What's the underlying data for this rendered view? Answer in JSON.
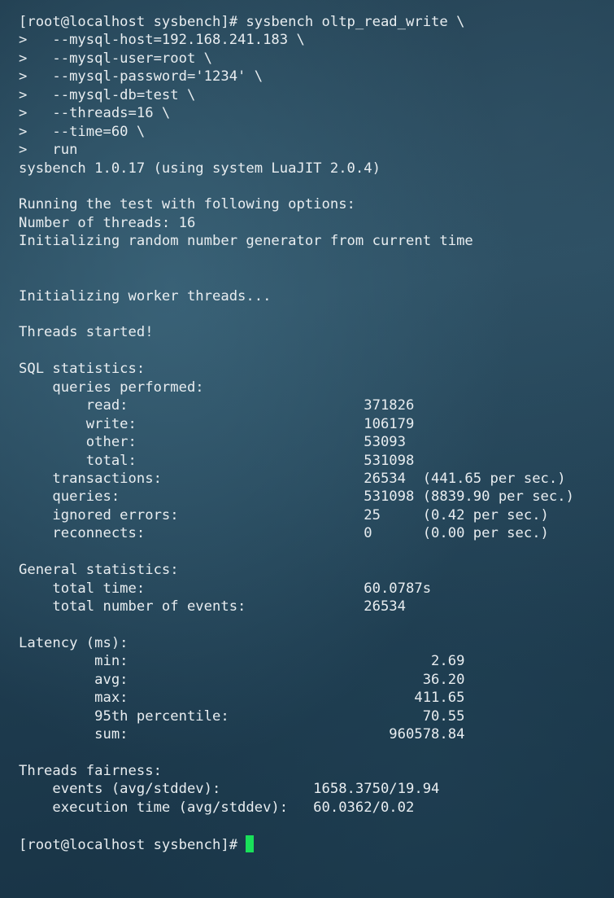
{
  "terminal": {
    "lines": [
      "[root@localhost sysbench]# sysbench oltp_read_write \\",
      ">   --mysql-host=192.168.241.183 \\",
      ">   --mysql-user=root \\",
      ">   --mysql-password='1234' \\",
      ">   --mysql-db=test \\",
      ">   --threads=16 \\",
      ">   --time=60 \\",
      ">   run",
      "sysbench 1.0.17 (using system LuaJIT 2.0.4)",
      "",
      "Running the test with following options:",
      "Number of threads: 16",
      "Initializing random number generator from current time",
      "",
      "",
      "Initializing worker threads...",
      "",
      "Threads started!",
      "",
      "SQL statistics:",
      "    queries performed:",
      "        read:                            371826",
      "        write:                           106179",
      "        other:                           53093",
      "        total:                           531098",
      "    transactions:                        26534  (441.65 per sec.)",
      "    queries:                             531098 (8839.90 per sec.)",
      "    ignored errors:                      25     (0.42 per sec.)",
      "    reconnects:                          0      (0.00 per sec.)",
      "",
      "General statistics:",
      "    total time:                          60.0787s",
      "    total number of events:              26534",
      "",
      "Latency (ms):",
      "         min:                                    2.69",
      "         avg:                                   36.20",
      "         max:                                  411.65",
      "         95th percentile:                       70.55",
      "         sum:                               960578.84",
      "",
      "Threads fairness:",
      "    events (avg/stddev):           1658.3750/19.94",
      "    execution time (avg/stddev):   60.0362/0.02",
      ""
    ],
    "prompt": "[root@localhost sysbench]# "
  },
  "colors": {
    "foreground": "#e8edf0",
    "cursor": "#19e05a",
    "background": "#1e3a4c"
  }
}
